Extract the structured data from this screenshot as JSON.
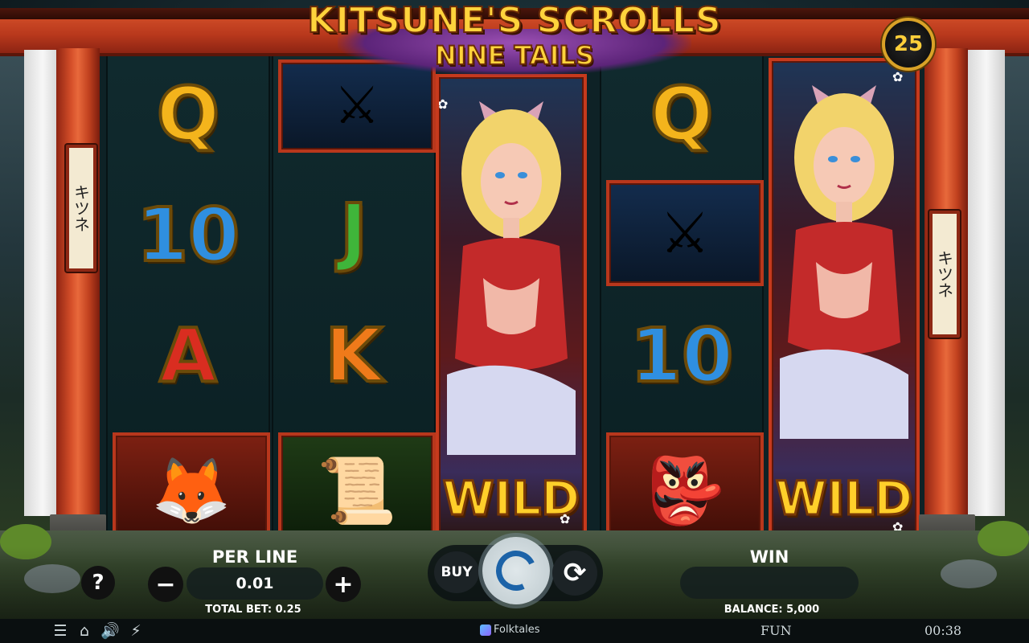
{
  "game": {
    "title": "KITSUNE'S SCROLLS",
    "subtitle": "NINE TAILS",
    "lines": "25"
  },
  "signs": {
    "left": "キツネ",
    "right": "キツネ"
  },
  "reels": {
    "reel1": [
      "Q",
      "10",
      "A",
      "fire-fox"
    ],
    "reel2": [
      "katana",
      "J",
      "K",
      "scroll"
    ],
    "reel3": [
      "fox-girl-wild",
      "WILD"
    ],
    "reel4": [
      "Q",
      "katana",
      "10",
      "fox-mask"
    ],
    "reel5": [
      "fox-girl-wild",
      "WILD"
    ]
  },
  "symbols": {
    "q": "Q",
    "ten": "10",
    "j": "J",
    "k": "K",
    "a": "A",
    "wild": "WILD"
  },
  "controls": {
    "help": "?",
    "per_line_label": "PER LINE",
    "per_line_value": "0.01",
    "minus": "−",
    "plus": "+",
    "total_bet": "TOTAL BET: 0.25",
    "buy": "BUY",
    "win_label": "WIN",
    "win_value": "",
    "balance": "BALANCE: 5,000"
  },
  "bottom_bar": {
    "brand": "Folktales",
    "mode": "FUN",
    "clock": "00:38"
  },
  "icons": [
    "menu-icon",
    "home-icon",
    "sound-icon",
    "speed-icon",
    "spin-icon",
    "autoplay-icon"
  ],
  "colors": {
    "torii_red": "#d6502a",
    "gold": "#f4b41c",
    "spin_blue": "#1c63a8"
  }
}
